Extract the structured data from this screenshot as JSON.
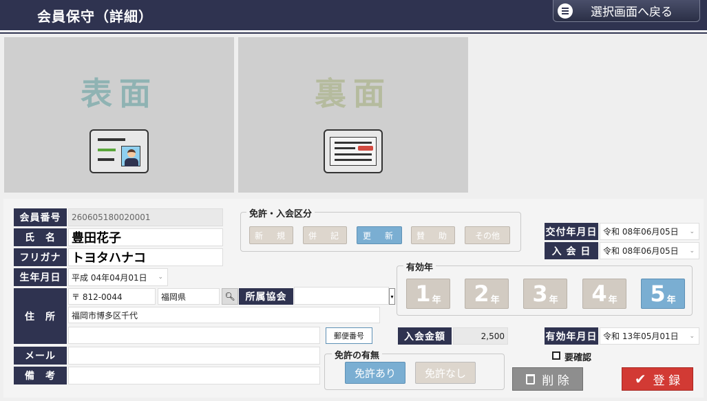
{
  "header": {
    "title": "会員保守（詳細）",
    "back_button": "選択画面へ戻る",
    "back_icon": "list-icon"
  },
  "cards": {
    "front_label": "表面",
    "back_label": "裏面"
  },
  "member": {
    "number_label": "会員番号",
    "number_value": "260605180020001",
    "name_label": "氏　名",
    "name_value": "豊田花子",
    "kana_label": "フリガナ",
    "kana_value": "トヨタハナコ",
    "birth_label": "生年月日",
    "birth_value": "平成 04年04月01日",
    "address_label": "住　所",
    "postal_value": "〒 812-0044",
    "pref_value": "福岡県",
    "assoc_label": "所属協会",
    "assoc_value": "",
    "address_value": "福岡市博多区千代",
    "address2_value": "",
    "postal_button": "郵便番号",
    "mail_label": "メール",
    "mail_value": "",
    "note_label": "備　考",
    "note_value": ""
  },
  "license_type": {
    "title": "免許・入会区分",
    "options": [
      "新　規",
      "併　記",
      "更　新",
      "賛　助",
      "その他"
    ],
    "selected": "更　新"
  },
  "dates": {
    "issue_label": "交付年月日",
    "issue_value": "令和 08年06月05日",
    "join_label": "入 会 日",
    "join_value": "令和 08年06月05日",
    "expiry_label": "有効年月日",
    "expiry_value": "令和 13年05月01日"
  },
  "validity": {
    "title": "有効年",
    "years": [
      {
        "num": "1",
        "unit": "年"
      },
      {
        "num": "2",
        "unit": "年"
      },
      {
        "num": "3",
        "unit": "年"
      },
      {
        "num": "4",
        "unit": "年"
      },
      {
        "num": "5",
        "unit": "年"
      }
    ],
    "selected": "5"
  },
  "fee": {
    "label": "入会金額",
    "value": "2,500"
  },
  "license_presence": {
    "title": "免許の有無",
    "yes": "免許あり",
    "no": "免許なし",
    "selected": "免許あり"
  },
  "confirm": {
    "label": "要確認",
    "checked": false
  },
  "actions": {
    "delete": "削 除",
    "register": "登 録"
  },
  "colors": {
    "navy": "#2f3350",
    "selected_blue": "#7aaed2",
    "register_red": "#d23a34",
    "front_text": "#8fb3b3",
    "back_text": "#b5bb9e"
  }
}
